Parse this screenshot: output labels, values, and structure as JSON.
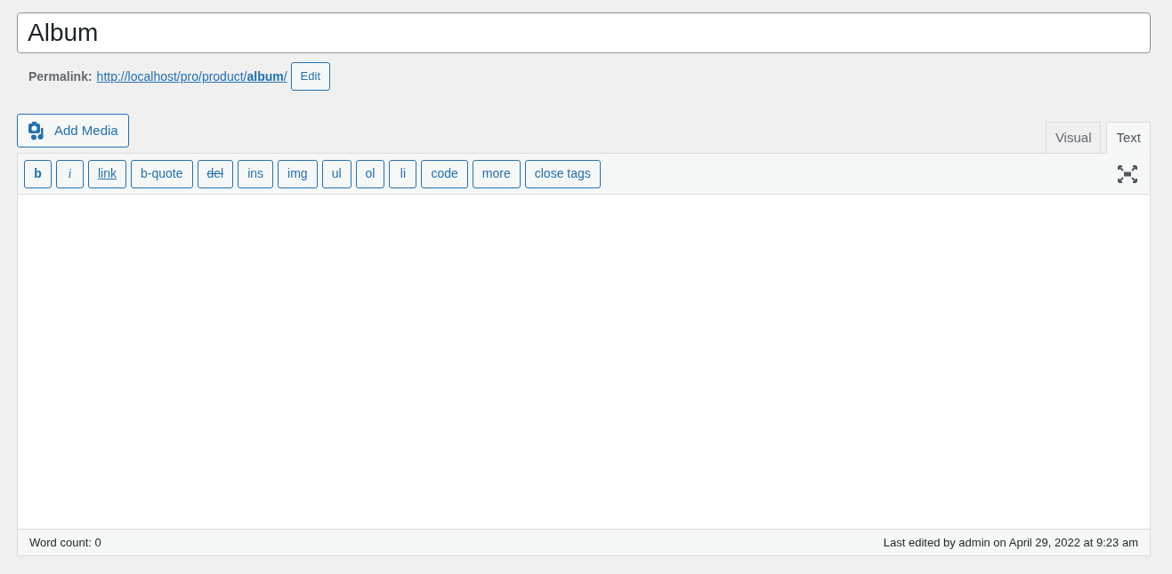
{
  "title_field": {
    "value": "Album"
  },
  "permalink": {
    "label": "Permalink:",
    "url": "http://localhost/pro/product/**album**/",
    "edit_button": "Edit"
  },
  "add_media_button": "Add Media",
  "tabs": [
    {
      "label": "Visual",
      "selected": false
    },
    {
      "label": "Text",
      "selected": true
    }
  ],
  "toolbar": [
    {
      "label": "b",
      "kind": "bold"
    },
    {
      "label": "i",
      "kind": "italic"
    },
    {
      "label": "link",
      "kind": "underline"
    },
    {
      "label": "b-quote",
      "kind": "plain"
    },
    {
      "label": "del",
      "kind": "strike"
    },
    {
      "label": "ins",
      "kind": "plain"
    },
    {
      "label": "img",
      "kind": "plain"
    },
    {
      "label": "ul",
      "kind": "plain"
    },
    {
      "label": "ol",
      "kind": "plain"
    },
    {
      "label": "li",
      "kind": "plain"
    },
    {
      "label": "code",
      "kind": "plain"
    },
    {
      "label": "more",
      "kind": "plain"
    },
    {
      "label": "close tags",
      "kind": "plain"
    }
  ],
  "status_bar": {
    "word_count": "Word count: 0",
    "last_edited": "Last edited by admin on April 29, 2022 at 9:23 am"
  }
}
